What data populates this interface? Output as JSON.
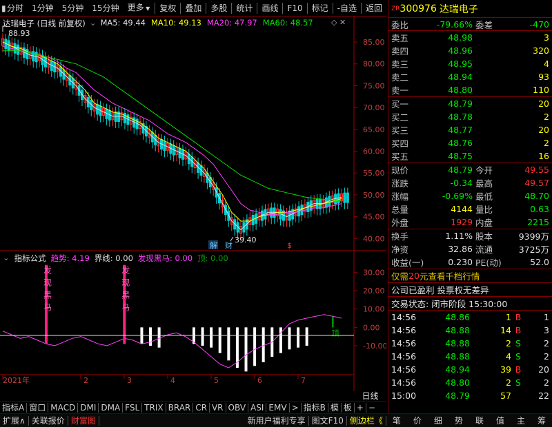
{
  "toolbar": {
    "periods": [
      "分时",
      "1分钟",
      "5分钟",
      "15分钟",
      "更多"
    ],
    "actions": [
      "复权",
      "叠加",
      "多股",
      "统计",
      "画线",
      "F10",
      "标记",
      "-自选",
      "返回"
    ]
  },
  "chart_header": {
    "title": "达瑞电子 (日线 前复权)",
    "ma_labels": [
      {
        "text": "MA5: 49.44",
        "color": "#e0e0e0"
      },
      {
        "text": "MA10: 49.13",
        "color": "#ffff00"
      },
      {
        "text": "MA20: 47.97",
        "color": "#ff40ff"
      },
      {
        "text": "MA60: 48.57",
        "color": "#00e000"
      }
    ]
  },
  "indicator_header": {
    "name": "指标公式",
    "items": [
      {
        "text": "趋势: 4.19",
        "color": "#ff40ff"
      },
      {
        "text": "界线: 0.00",
        "color": "#e0e0e0"
      },
      {
        "text": "发现黑马: 0.00",
        "color": "#ff40ff"
      },
      {
        "text": "顶: 0.00",
        "color": "#00a000"
      }
    ]
  },
  "annotations": {
    "high": "88.93",
    "low": "39.40",
    "tag_jie": "解",
    "tag_cai": "财",
    "tag_dollar": "$",
    "signal_text": "发现黑马",
    "top_text": "顶"
  },
  "chart_data": [
    {
      "type": "line",
      "name": "price-ma",
      "y_ticks": [
        "85.00",
        "80.00",
        "75.00",
        "70.00",
        "65.00",
        "60.00",
        "55.00",
        "50.00",
        "45.00",
        "40.00"
      ],
      "ylim": [
        38,
        88
      ],
      "series": [
        {
          "name": "MA5",
          "color": "#e0e0e0",
          "values": [
            85,
            84,
            83,
            82,
            81.5,
            80,
            79,
            77,
            75,
            72,
            70,
            69,
            68,
            68,
            67,
            66,
            64,
            62,
            61,
            60,
            59,
            57,
            55,
            52,
            48,
            44,
            42,
            44,
            45,
            46,
            46,
            45,
            46,
            47,
            48,
            48,
            49,
            49.44
          ]
        },
        {
          "name": "MA10",
          "color": "#ffff00",
          "values": [
            85,
            84,
            83.5,
            82.5,
            82,
            81,
            80,
            78,
            76,
            74,
            71,
            70,
            69,
            68.5,
            67.5,
            66.5,
            65,
            63,
            62,
            61,
            60,
            58,
            56,
            53,
            50,
            46,
            44,
            44,
            45,
            45.5,
            46,
            46,
            46.5,
            47,
            47.5,
            48,
            48.5,
            49.13
          ]
        },
        {
          "name": "MA20",
          "color": "#ff40ff",
          "values": [
            84,
            83.5,
            83,
            82.5,
            82,
            81.5,
            80.5,
            79,
            78,
            76,
            74,
            72.5,
            71,
            70,
            69,
            68,
            67,
            65.5,
            64,
            63,
            62,
            60.5,
            59,
            57,
            54,
            51,
            48,
            46.5,
            46,
            45.5,
            45.5,
            46,
            46,
            46.5,
            47,
            47,
            47.5,
            47.97
          ]
        },
        {
          "name": "MA60",
          "color": "#00e000",
          "values": [
            83,
            83,
            83,
            82.5,
            82,
            81.5,
            81,
            80.5,
            80,
            79,
            78,
            77,
            75.5,
            74,
            72.5,
            71,
            69.5,
            68,
            66.5,
            65,
            63.5,
            62,
            60.5,
            59,
            57.5,
            56,
            54.5,
            53.5,
            52.5,
            51.5,
            51,
            50.5,
            50,
            49.5,
            49.2,
            49,
            48.8,
            48.57
          ]
        }
      ]
    },
    {
      "type": "bar",
      "name": "indicator",
      "y_ticks": [
        "30.00",
        "20.00",
        "10.00",
        "0.00",
        "-10.00"
      ],
      "ylim": [
        -25,
        35
      ],
      "x_labels": [
        "2021年",
        "2",
        "3",
        "4",
        "5",
        "6",
        "7"
      ],
      "trend": [
        -2,
        -4,
        -6,
        -5,
        -7,
        -9,
        -10,
        -8,
        -6,
        -5,
        -7,
        -9,
        -10,
        -8,
        -6,
        -7,
        -9,
        -8,
        -6,
        -4,
        -3,
        -5,
        -8,
        -12,
        -16,
        -20,
        -22,
        -19,
        -15,
        -12,
        -10,
        -8,
        -3,
        2,
        4,
        5,
        6,
        7,
        6,
        5
      ],
      "bars": [
        0,
        0,
        0,
        0,
        0,
        0,
        0,
        0,
        0,
        0,
        0,
        0,
        0,
        0,
        0,
        0,
        -9,
        -10,
        -11,
        0,
        0,
        0,
        -9,
        -10,
        -11,
        -14,
        -18,
        -22,
        -24,
        -21,
        -19,
        -16,
        -14,
        -12,
        -11,
        -10,
        0,
        0,
        0,
        0
      ],
      "signals": [
        5,
        14
      ],
      "top_signal": 38
    }
  ],
  "stock": {
    "zr": "ZR",
    "code": "300976",
    "name": "达瑞电子"
  },
  "quote": {
    "weibi_label": "委比",
    "weibi": "-79.66%",
    "weicha_label": "委差",
    "weicha": "-470",
    "asks": [
      {
        "label": "卖五",
        "price": "48.98",
        "vol": "3"
      },
      {
        "label": "卖四",
        "price": "48.96",
        "vol": "320"
      },
      {
        "label": "卖三",
        "price": "48.95",
        "vol": "4"
      },
      {
        "label": "卖二",
        "price": "48.94",
        "vol": "93"
      },
      {
        "label": "卖一",
        "price": "48.80",
        "vol": "110"
      }
    ],
    "bids": [
      {
        "label": "买一",
        "price": "48.79",
        "vol": "20"
      },
      {
        "label": "买二",
        "price": "48.78",
        "vol": "2"
      },
      {
        "label": "买三",
        "price": "48.77",
        "vol": "20"
      },
      {
        "label": "买四",
        "price": "48.76",
        "vol": "2"
      },
      {
        "label": "买五",
        "price": "48.75",
        "vol": "16"
      }
    ],
    "stats": [
      {
        "l1": "现价",
        "v1": "48.79",
        "c1": "#00e600",
        "l2": "今开",
        "v2": "49.55",
        "c2": "#ff3030"
      },
      {
        "l1": "涨跌",
        "v1": "-0.34",
        "c1": "#00e600",
        "l2": "最高",
        "v2": "49.57",
        "c2": "#ff3030"
      },
      {
        "l1": "涨幅",
        "v1": "-0.69%",
        "c1": "#00e600",
        "l2": "最低",
        "v2": "48.70",
        "c2": "#00e600"
      },
      {
        "l1": "总量",
        "v1": "4144",
        "c1": "#ffff00",
        "l2": "量比",
        "v2": "0.63",
        "c2": "#00e600"
      },
      {
        "l1": "外盘",
        "v1": "1929",
        "c1": "#ff3030",
        "l2": "内盘",
        "v2": "2215",
        "c2": "#00e600"
      }
    ],
    "stats2": [
      {
        "l1": "换手",
        "v1": "1.11%",
        "l2": "股本",
        "v2": "9399万"
      },
      {
        "l1": "净资",
        "v1": "32.86",
        "l2": "流通",
        "v2": "3725万"
      },
      {
        "l1": "收益(一)",
        "v1": "0.230",
        "l2": "PE(动)",
        "v2": "52.0"
      }
    ],
    "promo_pre": "仅需",
    "promo_num": "20",
    "promo_post": "元查看千档行情",
    "company_note": "公司已盈利 投票权无差异",
    "trade_status": "交易状态: 闭市阶段 15:30:00",
    "ticks": [
      {
        "t": "14:56",
        "p": "48.86",
        "v": "1",
        "s": "B"
      },
      {
        "t": "14:56",
        "p": "48.88",
        "v": "14",
        "s": "B"
      },
      {
        "t": "14:56",
        "p": "48.88",
        "v": "2",
        "s": "S"
      },
      {
        "t": "14:56",
        "p": "48.88",
        "v": "4",
        "s": "S"
      },
      {
        "t": "14:56",
        "p": "48.94",
        "v": "39",
        "s": "B"
      },
      {
        "t": "14:56",
        "p": "48.80",
        "v": "2",
        "s": "S"
      },
      {
        "t": "15:00",
        "p": "48.79",
        "v": "57",
        "s": ""
      }
    ],
    "tick_extra": [
      "1",
      "3",
      "2",
      "2",
      "20",
      "2",
      "22"
    ]
  },
  "indicator_tabs": [
    "指标A",
    "窗口",
    "MACD",
    "DMI",
    "DMA",
    "FSL",
    "TRIX",
    "BRAR",
    "CR",
    "VR",
    "OBV",
    "ASI",
    "EMV",
    ">",
    "指标B",
    "模",
    "板",
    "+",
    "−"
  ],
  "date_label": "日线",
  "status_bar": {
    "left": [
      "扩展∧",
      "关联报价",
      "财富图"
    ],
    "right": [
      "新用户福利专享",
      "图文F10",
      "侧边栏《"
    ],
    "icons": [
      "笔",
      "价",
      "细",
      "势",
      "联",
      "值",
      "主",
      "筹"
    ]
  }
}
